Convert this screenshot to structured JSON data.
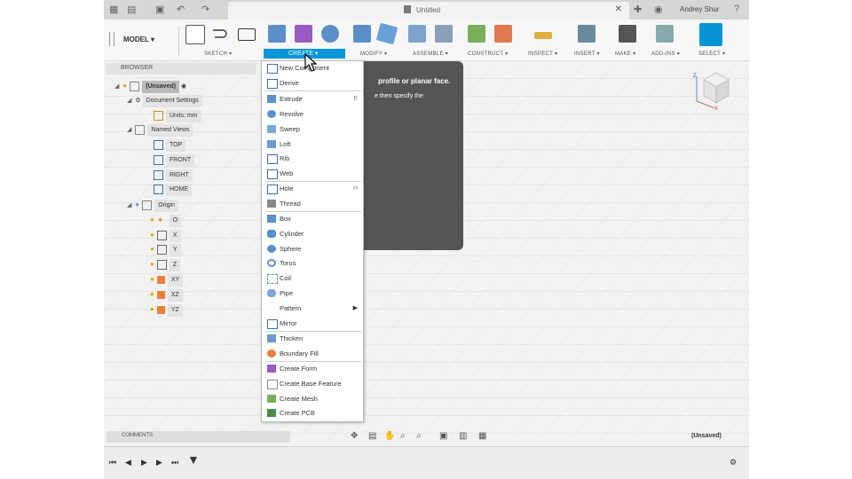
{
  "window": {
    "document_title": "Untitled",
    "user_name": "Andrey Shur"
  },
  "toolbar": {
    "workspace": "MODEL",
    "groups": [
      "SKETCH ▾",
      "CREATE ▾",
      "MODIFY ▾",
      "ASSEMBLE ▾",
      "CONSTRUCT ▾",
      "INSPECT ▾",
      "INSERT ▾",
      "MAKE ▾",
      "ADD-INS ▾",
      "SELECT ▾"
    ]
  },
  "browser": {
    "title": "BROWSER",
    "root_label": "(Unsaved)",
    "document_settings": "Document Settings",
    "units": "Units: mm",
    "named_views": "Named Views",
    "views": [
      "TOP",
      "FRONT",
      "RIGHT",
      "HOME"
    ],
    "origin": "Origin",
    "origin_items": [
      "O",
      "X",
      "Y",
      "Z",
      "XY",
      "XZ",
      "YZ"
    ]
  },
  "dialog": {
    "line1": "profile or planar face.",
    "line2": "e then specify the"
  },
  "create_menu": {
    "items": [
      {
        "label": "New Component"
      },
      {
        "label": "Derive"
      },
      {
        "label": "Extrude",
        "shortcut": "E"
      },
      {
        "label": "Revolve"
      },
      {
        "label": "Sweep"
      },
      {
        "label": "Loft"
      },
      {
        "label": "Rib"
      },
      {
        "label": "Web"
      },
      {
        "label": "Hole",
        "shortcut": "H"
      },
      {
        "label": "Thread"
      },
      {
        "label": "Box"
      },
      {
        "label": "Cylinder"
      },
      {
        "label": "Sphere"
      },
      {
        "label": "Torus"
      },
      {
        "label": "Coil"
      },
      {
        "label": "Pipe"
      },
      {
        "label": "Pattern",
        "submenu": "▶"
      },
      {
        "label": "Mirror"
      },
      {
        "label": "Thicken"
      },
      {
        "label": "Boundary Fill"
      },
      {
        "label": "Create Form"
      },
      {
        "label": "Create Base Feature"
      },
      {
        "label": "Create Mesh"
      },
      {
        "label": "Create PCB"
      }
    ]
  },
  "bottom": {
    "comments": "COMMENTS",
    "status": "(Unsaved)"
  },
  "colors": {
    "accent": "#0696d7",
    "dialog_bg": "#555555",
    "bulb": "#e0a800",
    "plane": "#e8823a"
  }
}
